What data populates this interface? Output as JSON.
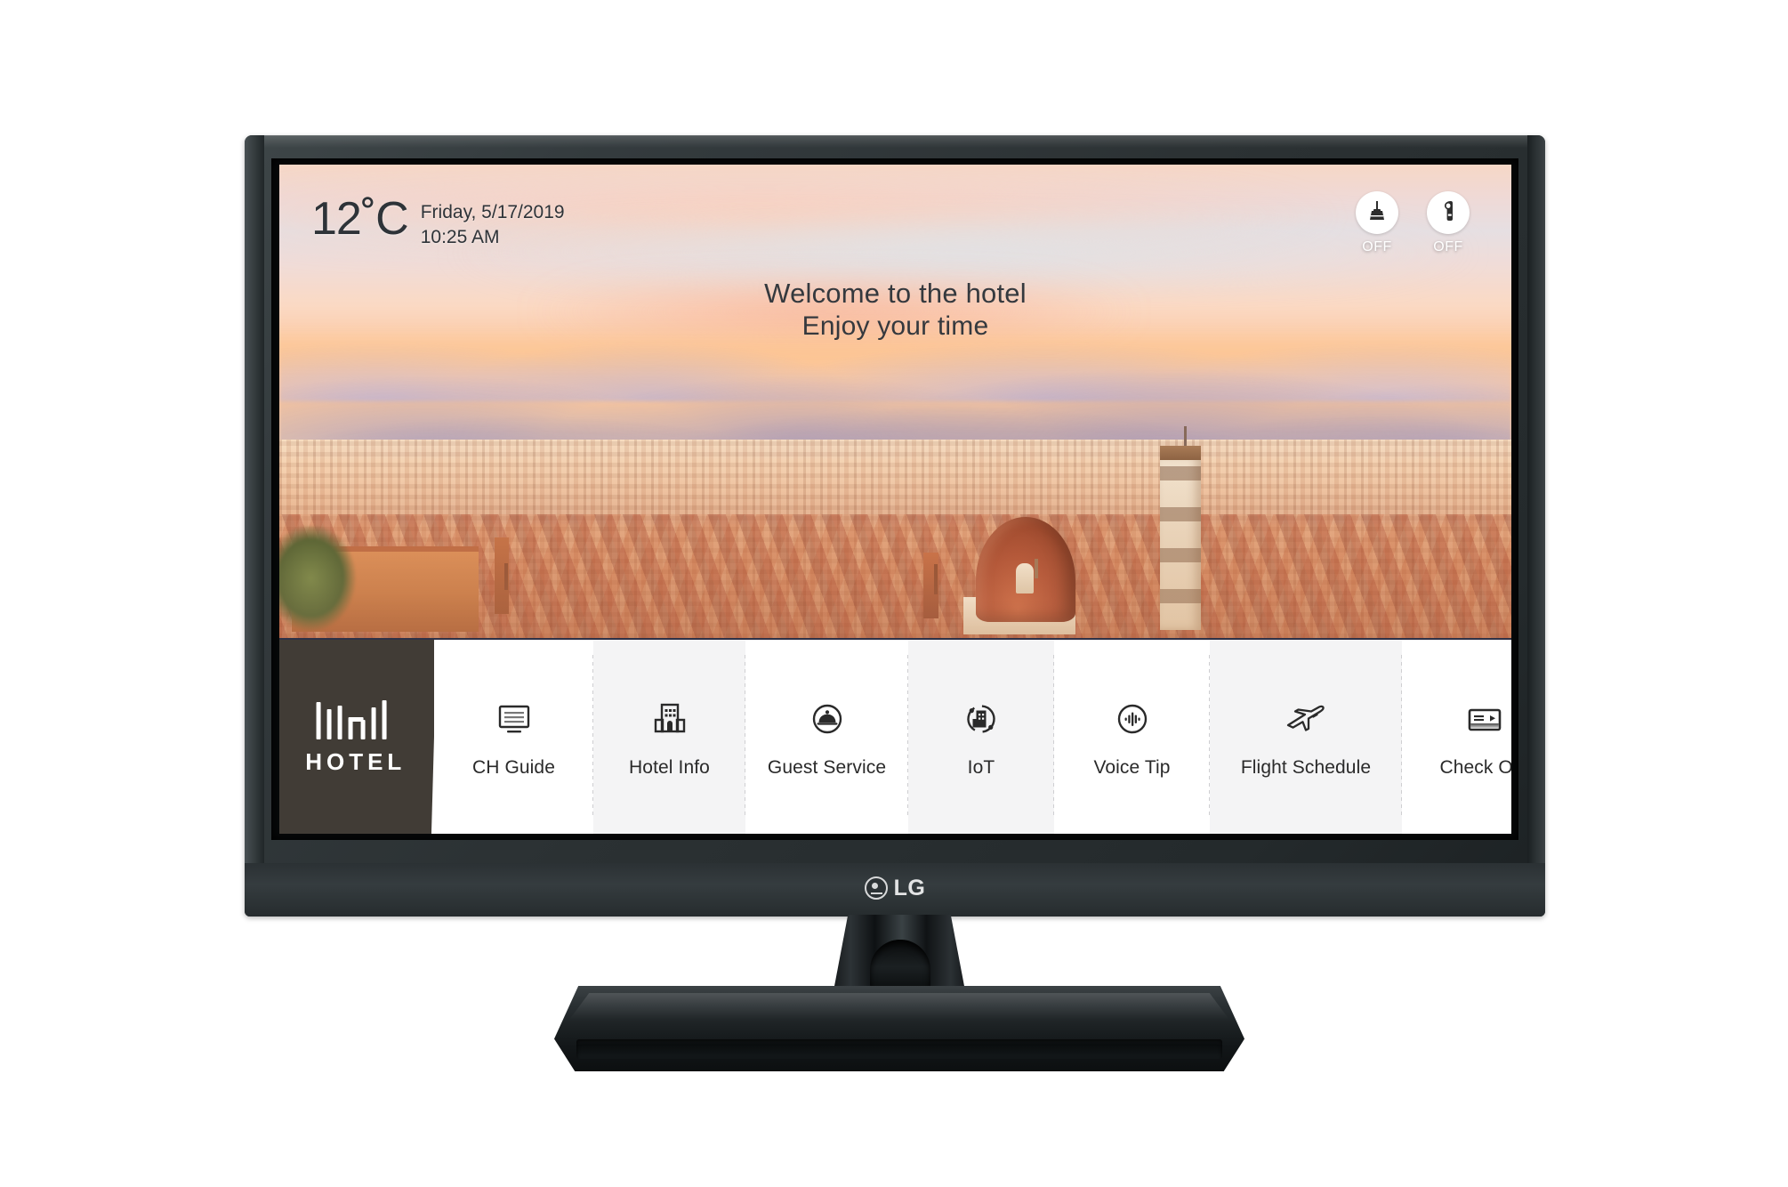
{
  "device": {
    "brand": "LG",
    "brand_mark": "lg-circle-logo"
  },
  "screen": {
    "status": {
      "temperature": "12˚C",
      "date": "Friday, 5/17/2019",
      "time": "10:25 AM"
    },
    "service_toggles": [
      {
        "icon": "housekeeping-broom-icon",
        "label": "OFF",
        "name": "make-up-room-toggle"
      },
      {
        "icon": "do-not-disturb-door-hanger-icon",
        "label": "OFF",
        "name": "do-not-disturb-toggle"
      }
    ],
    "welcome": {
      "title": "Welcome to the hotel",
      "subtitle": "Enjoy your time"
    },
    "menu": {
      "brand": {
        "logo_mark": "hotel-building-logo-icon",
        "text": "HOTEL"
      },
      "items": [
        {
          "label": "CH Guide",
          "icon": "channel-guide-screen-icon"
        },
        {
          "label": "Hotel Info",
          "icon": "hotel-building-icon"
        },
        {
          "label": "Guest Service",
          "icon": "service-bell-icon"
        },
        {
          "label": "IoT",
          "icon": "iot-connected-building-icon"
        },
        {
          "label": "Voice Tip",
          "icon": "voice-waveform-icon"
        },
        {
          "label": "Flight Schedule",
          "icon": "airplane-icon"
        },
        {
          "label": "Check Out",
          "icon": "key-card-icon"
        }
      ]
    }
  },
  "colors": {
    "brand_tile_bg": "#413c36",
    "menu_bg": "#ffffff",
    "menu_top_border": "#2f3146",
    "bezel": "#2b3133",
    "text_dark": "#2a2a2a",
    "toggle_label": "#ffffff"
  }
}
